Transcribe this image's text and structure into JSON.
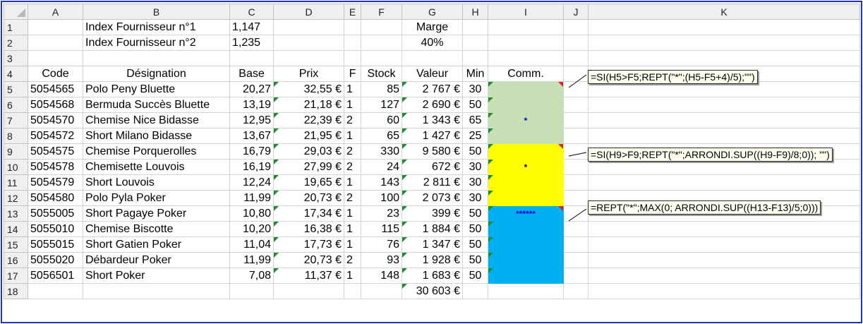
{
  "columns": [
    "A",
    "B",
    "C",
    "D",
    "E",
    "F",
    "G",
    "H",
    "I",
    "J",
    "K"
  ],
  "rows": [
    {
      "num": "1",
      "A": "",
      "B": "Index Fournisseur n°1",
      "C": "1,147",
      "D": "",
      "E": "",
      "F": "",
      "G": "Marge",
      "H": "",
      "I": "",
      "J": "",
      "K": ""
    },
    {
      "num": "2",
      "A": "",
      "B": "Index Fournisseur n°2",
      "C": "1,235",
      "D": "",
      "E": "",
      "F": "",
      "G": "40%",
      "H": "",
      "I": "",
      "J": "",
      "K": ""
    },
    {
      "num": "3",
      "A": "",
      "B": "",
      "C": "",
      "D": "",
      "E": "",
      "F": "",
      "G": "",
      "H": "",
      "I": "",
      "J": "",
      "K": ""
    },
    {
      "num": "4",
      "A": "Code",
      "B": "Désignation",
      "C": "Base",
      "D": "Prix",
      "E": "F",
      "F": "Stock",
      "G": "Valeur",
      "H": "Min",
      "I": "Comm.",
      "J": "",
      "K": ""
    },
    {
      "num": "5",
      "A": "5054565",
      "B": "Polo Peny Bluette",
      "C": "20,27",
      "D": "32,55 €",
      "E": "1",
      "F": "85",
      "G": "2 767 €",
      "H": "30",
      "I": "",
      "J": "",
      "K": ""
    },
    {
      "num": "6",
      "A": "5054568",
      "B": "Bermuda Succès Bluette",
      "C": "13,19",
      "D": "21,18 €",
      "E": "1",
      "F": "127",
      "G": "2 690 €",
      "H": "50",
      "I": "",
      "J": "",
      "K": ""
    },
    {
      "num": "7",
      "A": "5054570",
      "B": "Chemise Nice Bidasse",
      "C": "12,95",
      "D": "22,39 €",
      "E": "2",
      "F": "60",
      "G": "1 343 €",
      "H": "65",
      "I": "*",
      "J": "",
      "K": ""
    },
    {
      "num": "8",
      "A": "5054572",
      "B": "Short Milano Bidasse",
      "C": "13,67",
      "D": "21,95 €",
      "E": "1",
      "F": "65",
      "G": "1 427 €",
      "H": "25",
      "I": "",
      "J": "",
      "K": ""
    },
    {
      "num": "9",
      "A": "5054575",
      "B": "Chemise Porquerolles",
      "C": "16,79",
      "D": "29,03 €",
      "E": "2",
      "F": "330",
      "G": "9 580 €",
      "H": "50",
      "I": "",
      "J": "",
      "K": ""
    },
    {
      "num": "10",
      "A": "5054578",
      "B": "Chemisette Louvois",
      "C": "16,19",
      "D": "27,99 €",
      "E": "2",
      "F": "24",
      "G": "672 €",
      "H": "30",
      "I": "*",
      "J": "",
      "K": ""
    },
    {
      "num": "11",
      "A": "5054579",
      "B": "Short Louvois",
      "C": "12,24",
      "D": "19,65 €",
      "E": "1",
      "F": "143",
      "G": "2 811 €",
      "H": "30",
      "I": "",
      "J": "",
      "K": ""
    },
    {
      "num": "12",
      "A": "5054580",
      "B": "Polo Pyla Poker",
      "C": "11,99",
      "D": "20,73 €",
      "E": "2",
      "F": "100",
      "G": "2 073 €",
      "H": "30",
      "I": "",
      "J": "",
      "K": ""
    },
    {
      "num": "13",
      "A": "5055005",
      "B": "Short Pagaye Poker",
      "C": "10,80",
      "D": "17,34 €",
      "E": "1",
      "F": "23",
      "G": "399 €",
      "H": "50",
      "I": "******",
      "J": "",
      "K": ""
    },
    {
      "num": "14",
      "A": "5055010",
      "B": "Chemise Biscotte",
      "C": "10,20",
      "D": "16,38 €",
      "E": "1",
      "F": "115",
      "G": "1 884 €",
      "H": "50",
      "I": "",
      "J": "",
      "K": ""
    },
    {
      "num": "15",
      "A": "5055015",
      "B": "Short Gatien Poker",
      "C": "11,04",
      "D": "17,73 €",
      "E": "1",
      "F": "76",
      "G": "1 347 €",
      "H": "50",
      "I": "",
      "J": "",
      "K": ""
    },
    {
      "num": "16",
      "A": "5055020",
      "B": "Débardeur Poker",
      "C": "11,99",
      "D": "20,73 €",
      "E": "2",
      "F": "93",
      "G": "1 928 €",
      "H": "50",
      "I": "",
      "J": "",
      "K": ""
    },
    {
      "num": "17",
      "A": "5056501",
      "B": "Short Poker",
      "C": "7,08",
      "D": "11,37 €",
      "E": "1",
      "F": "148",
      "G": "1 683 €",
      "H": "50",
      "I": "",
      "J": "",
      "K": ""
    },
    {
      "num": "18",
      "A": "",
      "B": "",
      "C": "",
      "D": "",
      "E": "",
      "F": "",
      "G": "30 603 €",
      "H": "",
      "I": "",
      "J": "",
      "K": ""
    }
  ],
  "callouts": [
    {
      "text": "=SI(H5>F5;REPT(\"*\";(H5-F5+4)/5);\"\")"
    },
    {
      "text": "=SI(H9>F9;REPT(\"*\";ARRONDI.SUP((H9-F9)/8;0)); \"\")"
    },
    {
      "text": "=REPT(\"*\";MAX(0; ARRONDI.SUP((H13-F13)/5;0)))"
    }
  ],
  "colors": {
    "green_fill": "#c6dfb4",
    "yellow_fill": "#ffff00",
    "blue_fill": "#00b0f0",
    "stars": "#0000cc",
    "frame": "#1f3aa8"
  }
}
